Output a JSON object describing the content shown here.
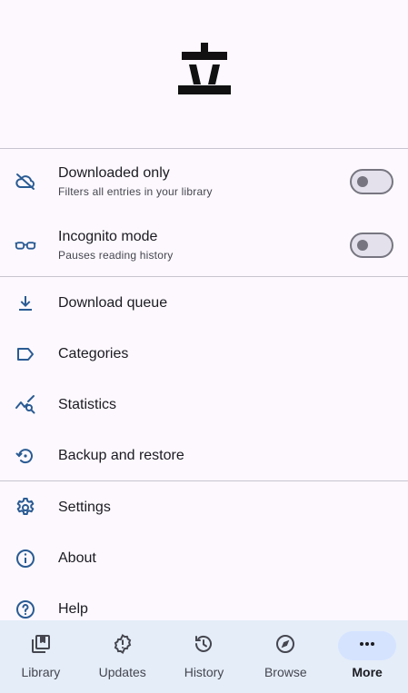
{
  "logo": {
    "glyph": "立"
  },
  "toggles": [
    {
      "title": "Downloaded only",
      "subtitle": "Filters all entries in your library",
      "icon": "cloud-off-icon",
      "on": false
    },
    {
      "title": "Incognito mode",
      "subtitle": "Pauses reading history",
      "icon": "glasses-icon",
      "on": false
    }
  ],
  "menu": [
    {
      "label": "Download queue",
      "icon": "download-icon"
    },
    {
      "label": "Categories",
      "icon": "label-icon"
    },
    {
      "label": "Statistics",
      "icon": "query-stats-icon"
    },
    {
      "label": "Backup and restore",
      "icon": "settings-backup-restore-icon"
    },
    {
      "label": "Settings",
      "icon": "gear-icon"
    },
    {
      "label": "About",
      "icon": "info-icon"
    },
    {
      "label": "Help",
      "icon": "help-icon"
    }
  ],
  "nav": {
    "items": [
      {
        "label": "Library",
        "icon": "library-icon"
      },
      {
        "label": "Updates",
        "icon": "updates-icon"
      },
      {
        "label": "History",
        "icon": "history-icon"
      },
      {
        "label": "Browse",
        "icon": "compass-icon"
      },
      {
        "label": "More",
        "icon": "more-horizontal-icon",
        "active": true
      }
    ]
  },
  "colors": {
    "accent": "#2a5b93",
    "background": "#fcf8fe",
    "nav_background": "#e4edf8",
    "active_pill": "#d5e3ff"
  }
}
